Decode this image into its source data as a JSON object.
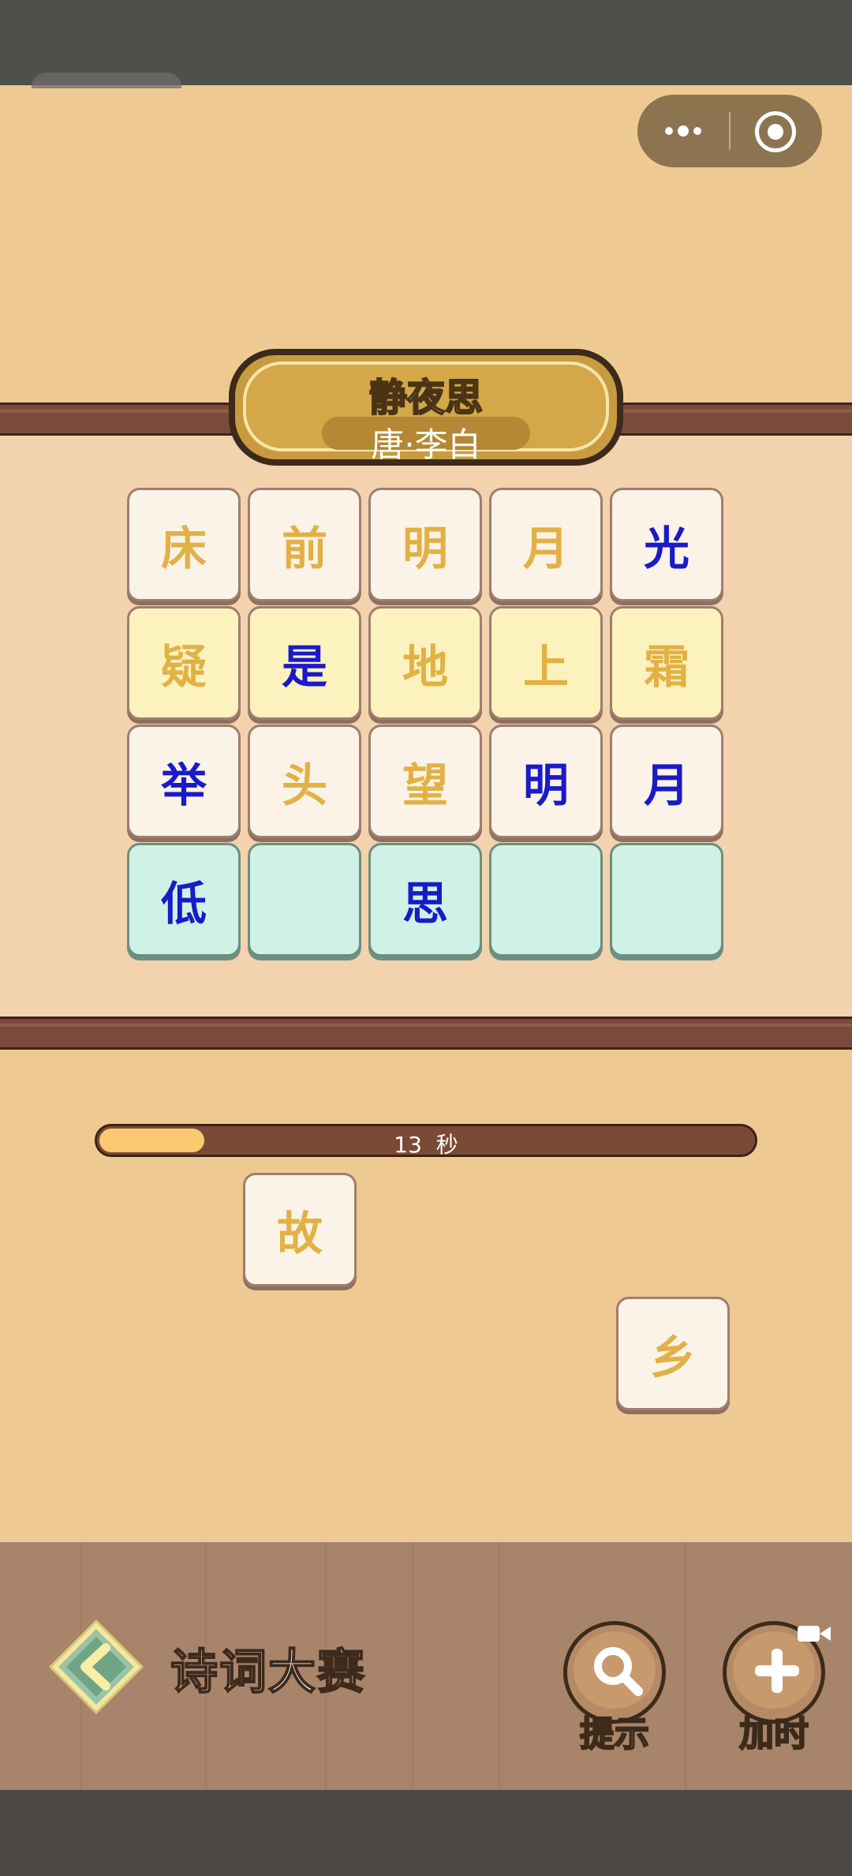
{
  "window": {
    "capsule": {
      "more_icon": "more-dots-icon",
      "close_icon": "target-circle-icon"
    }
  },
  "poem": {
    "title": "静夜思",
    "author": "唐·李白"
  },
  "grid": [
    [
      {
        "char": "床",
        "bg": "white",
        "color": "gold"
      },
      {
        "char": "前",
        "bg": "white",
        "color": "gold"
      },
      {
        "char": "明",
        "bg": "white",
        "color": "gold"
      },
      {
        "char": "月",
        "bg": "white",
        "color": "gold"
      },
      {
        "char": "光",
        "bg": "white",
        "color": "blue"
      }
    ],
    [
      {
        "char": "疑",
        "bg": "yellow",
        "color": "gold"
      },
      {
        "char": "是",
        "bg": "yellow",
        "color": "blue"
      },
      {
        "char": "地",
        "bg": "yellow",
        "color": "gold"
      },
      {
        "char": "上",
        "bg": "yellow",
        "color": "gold"
      },
      {
        "char": "霜",
        "bg": "yellow",
        "color": "gold"
      }
    ],
    [
      {
        "char": "举",
        "bg": "white",
        "color": "blue"
      },
      {
        "char": "头",
        "bg": "white",
        "color": "gold"
      },
      {
        "char": "望",
        "bg": "white",
        "color": "gold"
      },
      {
        "char": "明",
        "bg": "white",
        "color": "blue"
      },
      {
        "char": "月",
        "bg": "white",
        "color": "blue"
      }
    ],
    [
      {
        "char": "低",
        "bg": "mint",
        "color": "blue"
      },
      {
        "char": "",
        "bg": "mint",
        "color": "blue"
      },
      {
        "char": "思",
        "bg": "mint",
        "color": "blue"
      },
      {
        "char": "",
        "bg": "mint",
        "color": "blue"
      },
      {
        "char": "",
        "bg": "mint",
        "color": "blue"
      }
    ]
  ],
  "timer": {
    "seconds": "13",
    "unit": "秒",
    "remaining_fraction": 0.16
  },
  "floating_tiles": [
    "故",
    "乡"
  ],
  "footer": {
    "app_title": "诗词大赛",
    "hint_label": "提示",
    "add_time_label": "加时",
    "hint_icon": "magnifier-icon",
    "add_time_icon": "plus-icon",
    "video_badge_icon": "video-camera-icon",
    "back_icon": "back-arrow-icon"
  },
  "colors": {
    "gold_text": "#E2B145",
    "blue_text": "#1A1AC8",
    "board_bg": "#F3D2AE",
    "page_bg": "#EECA92"
  }
}
